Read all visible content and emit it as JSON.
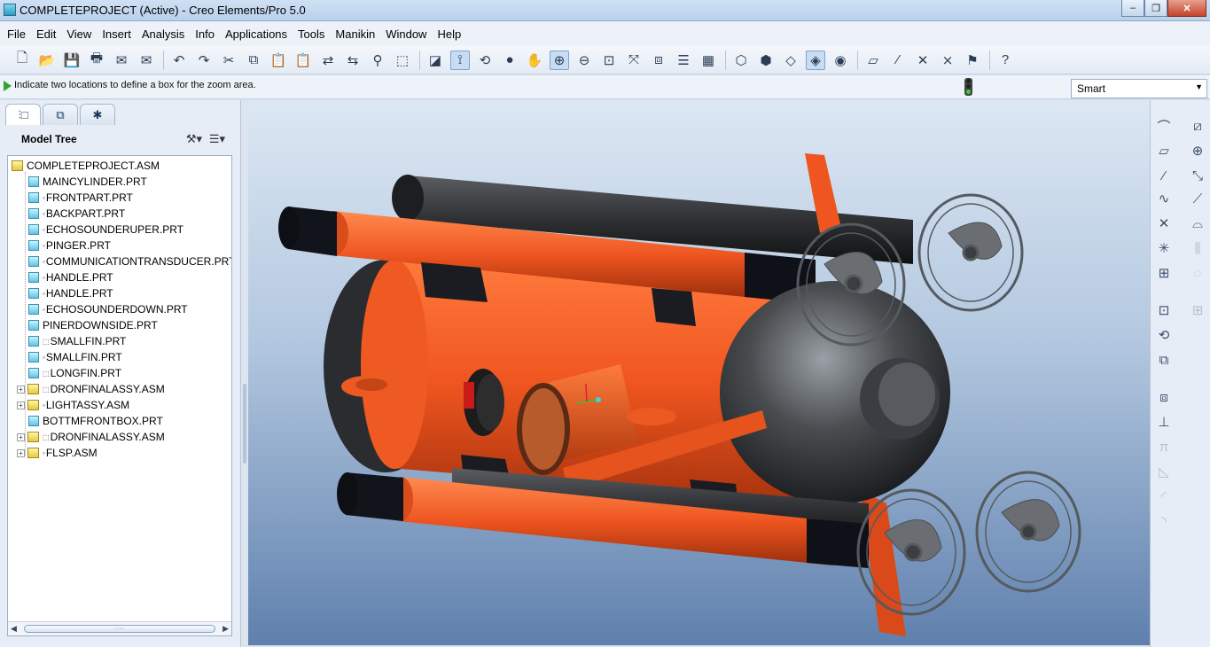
{
  "window": {
    "title": "COMPLETEPROJECT (Active) - Creo Elements/Pro 5.0",
    "minimize": "–",
    "maximize": "❐",
    "close": "✕"
  },
  "menu": [
    "File",
    "Edit",
    "View",
    "Insert",
    "Analysis",
    "Info",
    "Applications",
    "Tools",
    "Manikin",
    "Window",
    "Help"
  ],
  "toolbar": {
    "groups": [
      [
        "new-file-icon",
        "open-folder-icon",
        "save-icon",
        "print-icon",
        "send-mail-icon",
        "mail-attachment-icon"
      ],
      [
        "undo-icon",
        "redo-icon",
        "cut-icon",
        "copy-icon",
        "paste-icon",
        "paste-special-icon",
        "regenerate-icon",
        "regenerate-manager-icon",
        "find-icon",
        "select-box-icon"
      ],
      [
        "repaint-icon",
        "spin-center-icon",
        "orient-mode-icon",
        "appearance-icon",
        "pan-icon",
        "zoom-in-icon",
        "zoom-out-icon",
        "refit-icon",
        "reorient-icon",
        "saved-views-icon",
        "layers-icon",
        "view-manager-icon"
      ],
      [
        "wireframe-icon",
        "hidden-line-icon",
        "no-hidden-icon",
        "shading-icon",
        "enhanced-realism-icon"
      ],
      [
        "datum-planes-icon",
        "datum-axes-icon",
        "datum-points-icon",
        "coordinate-systems-icon",
        "annotations-icon"
      ],
      [
        "context-help-icon"
      ]
    ],
    "glyphs": {
      "new-file-icon": "🗋",
      "open-folder-icon": "📂",
      "save-icon": "💾",
      "print-icon": "🖶",
      "send-mail-icon": "✉",
      "mail-attachment-icon": "✉",
      "undo-icon": "↶",
      "redo-icon": "↷",
      "cut-icon": "✂",
      "copy-icon": "⧉",
      "paste-icon": "📋",
      "paste-special-icon": "📋",
      "regenerate-icon": "⇄",
      "regenerate-manager-icon": "⇆",
      "find-icon": "⚲",
      "select-box-icon": "⬚",
      "repaint-icon": "◪",
      "spin-center-icon": "⟟",
      "orient-mode-icon": "⟲",
      "appearance-icon": "●",
      "pan-icon": "✋",
      "zoom-in-icon": "⊕",
      "zoom-out-icon": "⊖",
      "refit-icon": "⊡",
      "reorient-icon": "⤧",
      "saved-views-icon": "⧈",
      "layers-icon": "☰",
      "view-manager-icon": "▦",
      "wireframe-icon": "⬡",
      "hidden-line-icon": "⬢",
      "no-hidden-icon": "◇",
      "shading-icon": "◈",
      "enhanced-realism-icon": "◉",
      "datum-planes-icon": "▱",
      "datum-axes-icon": "⁄",
      "datum-points-icon": "✕",
      "coordinate-systems-icon": "⨯",
      "annotations-icon": "⚑",
      "context-help-icon": "?"
    },
    "active": [
      "spin-center-icon",
      "zoom-in-icon",
      "shading-icon"
    ]
  },
  "message": {
    "text": "Indicate two locations to define a box for the zoom area.",
    "selection_filter": "Smart"
  },
  "panel": {
    "tabs": [
      "model-tree-tab-icon",
      "folder-browser-tab-icon",
      "favorites-tab-icon"
    ],
    "tab_glyphs": [
      "⫶□",
      "⧉",
      "✱"
    ],
    "tree_title": "Model Tree",
    "settings_glyph": "⚒▾",
    "show_glyph": "☰▾"
  },
  "model_tree": [
    {
      "label": "COMPLETEPROJECT.ASM",
      "type": "asm",
      "level": 0,
      "expand": ""
    },
    {
      "label": "MAINCYLINDER.PRT",
      "type": "prt",
      "level": 1,
      "expand": "",
      "mark": ""
    },
    {
      "label": "FRONTPART.PRT",
      "type": "prt",
      "level": 1,
      "expand": "",
      "mark": "▫"
    },
    {
      "label": "BACKPART.PRT",
      "type": "prt",
      "level": 1,
      "expand": "",
      "mark": "▫"
    },
    {
      "label": "ECHOSOUNDERUPER.PRT",
      "type": "prt",
      "level": 1,
      "expand": "",
      "mark": "▫"
    },
    {
      "label": "PINGER.PRT",
      "type": "prt",
      "level": 1,
      "expand": "",
      "mark": "▫"
    },
    {
      "label": "COMMUNICATIONTRANSDUCER.PRT",
      "type": "prt",
      "level": 1,
      "expand": "",
      "mark": "▫"
    },
    {
      "label": "HANDLE.PRT",
      "type": "prt",
      "level": 1,
      "expand": "",
      "mark": "▫"
    },
    {
      "label": "HANDLE.PRT",
      "type": "prt",
      "level": 1,
      "expand": "",
      "mark": "▫"
    },
    {
      "label": "ECHOSOUNDERDOWN.PRT",
      "type": "prt",
      "level": 1,
      "expand": "",
      "mark": "▫"
    },
    {
      "label": "PINERDOWNSIDE.PRT",
      "type": "prt",
      "level": 1,
      "expand": "",
      "mark": ""
    },
    {
      "label": "SMALLFIN.PRT",
      "type": "prt",
      "level": 1,
      "expand": "",
      "mark": "⬚"
    },
    {
      "label": "SMALLFIN.PRT",
      "type": "prt",
      "level": 1,
      "expand": "",
      "mark": "▫"
    },
    {
      "label": "LONGFIN.PRT",
      "type": "prt",
      "level": 1,
      "expand": "",
      "mark": "⬚"
    },
    {
      "label": "DRONFINALASSY.ASM",
      "type": "asm",
      "level": 1,
      "expand": "+",
      "mark": "⬚"
    },
    {
      "label": "LIGHTASSY.ASM",
      "type": "asm",
      "level": 1,
      "expand": "+",
      "mark": "▫"
    },
    {
      "label": "BOTTMFRONTBOX.PRT",
      "type": "prt",
      "level": 1,
      "expand": "",
      "mark": ""
    },
    {
      "label": "DRONFINALASSY.ASM",
      "type": "asm",
      "level": 1,
      "expand": "+",
      "mark": "⬚"
    },
    {
      "label": "FLSP.ASM",
      "type": "asm",
      "level": 1,
      "expand": "+",
      "mark": "▫"
    }
  ],
  "scroll": {
    "grip": "····",
    "left": "◀",
    "right": "▶"
  },
  "right_toolbar": {
    "left_column": [
      "sketch-tool-icon",
      "datum-plane-tool-icon",
      "datum-axis-tool-icon",
      "datum-curve-tool-icon",
      "datum-point-tool-icon",
      "datum-csys-tool-icon",
      "datum-analysis-tool-icon",
      "add-component-icon",
      "repeat-component-icon",
      "create-component-icon",
      "pattern-icon",
      "mirror-icon",
      "round-icon",
      "chamfer-icon",
      "draft-icon",
      "shell-icon"
    ],
    "right_column": [
      "offset-tool-icon",
      "axis-tool-icon",
      "extend-tool-icon",
      "intersect-tool-icon",
      "merge-tool-icon",
      "trim-tool-icon",
      "thicken-tool-icon",
      "solidify-tool-icon"
    ],
    "glyphs_left": [
      "⌒",
      "▱",
      "⁄",
      "∿",
      "✕",
      "✳",
      "⊞",
      "⊡",
      "⟲",
      "⧉",
      "⧈",
      "⊥",
      "π",
      "◺",
      "◜",
      "◝"
    ],
    "glyphs_right": [
      "⧄",
      "⊕",
      "⤡",
      "⟋",
      "⌓",
      "⫼",
      "◌",
      "⊞"
    ]
  },
  "colors": {
    "hull_orange": "#f0561f",
    "dark_grey": "#2e3033",
    "nose_grey": "#4a4d50",
    "frame_grey": "#555a5f"
  }
}
